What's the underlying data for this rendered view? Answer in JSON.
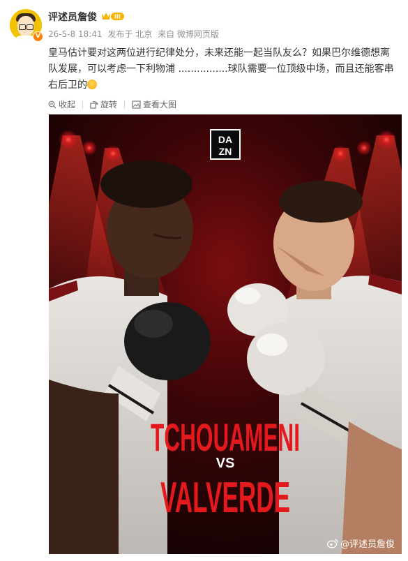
{
  "user": {
    "name": "评述员詹俊",
    "verified_badge": "V",
    "member_level": "III"
  },
  "meta": {
    "timestamp": "26-5-8 18:41",
    "location": "发布于 北京",
    "source": "来自 微博网页版"
  },
  "post": {
    "text": "皇马估计要对这两位进行纪律处分，未来还能一起当队友么？如果巴尔维德想离队发展，可以考虑一下利物浦 ................球队需要一位顶级中场，而且还能客串右后卫的"
  },
  "toolbar": {
    "collect": "收起",
    "rotate": "旋转",
    "view_large": "查看大图"
  },
  "poster": {
    "logo_top": "DA",
    "logo_bottom": "ZN",
    "name_top": "TCHOUAMENI",
    "vs": "VS",
    "name_bottom": "VALVERDE",
    "watermark": "@评述员詹俊"
  },
  "colors": {
    "accent_orange": "#ff8200",
    "poster_red": "#e3191e",
    "poster_bg": "#1a0405"
  }
}
